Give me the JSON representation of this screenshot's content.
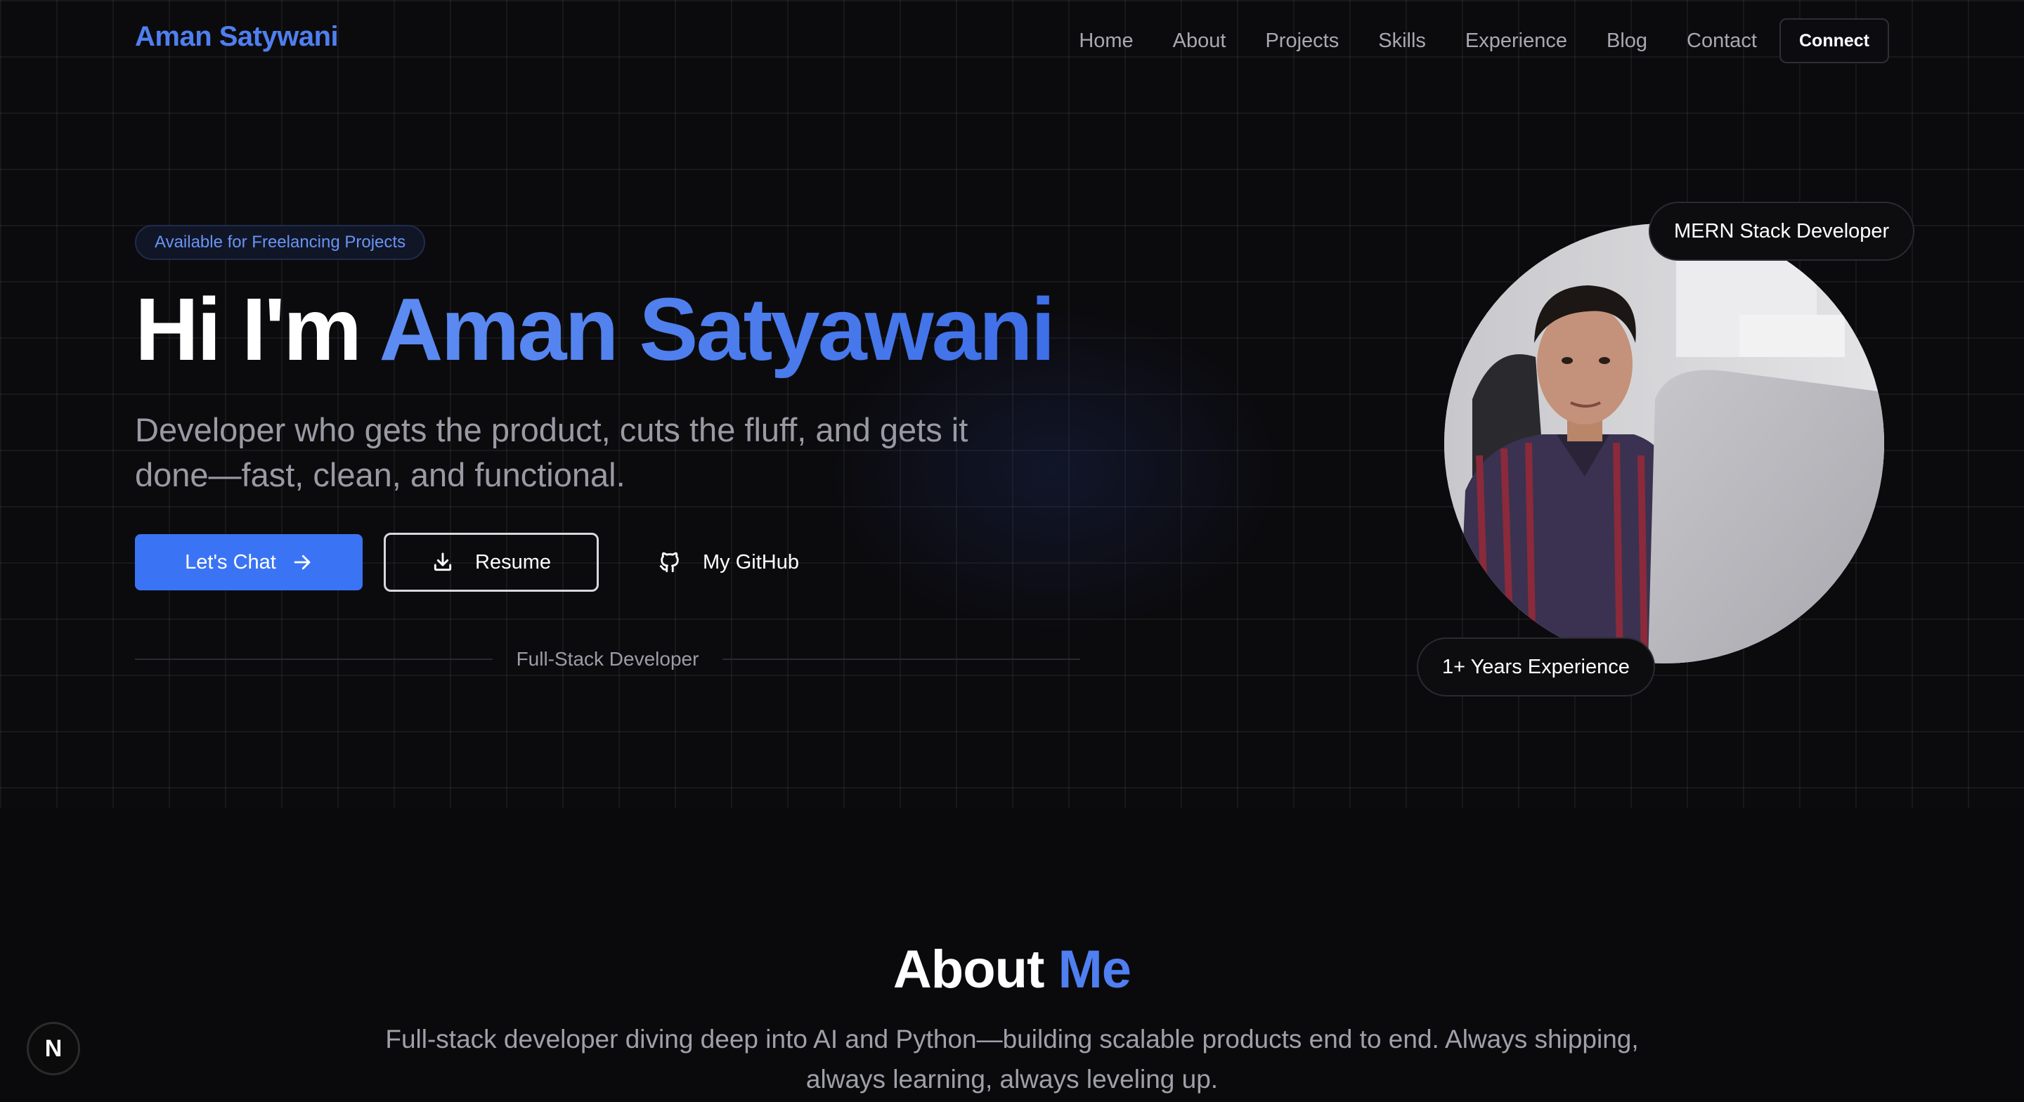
{
  "nav": {
    "brand": "Aman Satywani",
    "links": [
      "Home",
      "About",
      "Projects",
      "Skills",
      "Experience",
      "Blog",
      "Contact"
    ],
    "connect_label": "Connect"
  },
  "hero": {
    "badge": "Available for Freelancing Projects",
    "greeting": "Hi I'm",
    "name": "Aman Satyawani",
    "tagline": "Developer who gets the product, cuts the fluff, and gets it done—fast, clean, and functional.",
    "buttons": {
      "chat_label": "Let's Chat",
      "resume_label": "Resume",
      "github_label": "My GitHub"
    },
    "role": "Full-Stack Developer",
    "pills": {
      "top": "MERN Stack Developer",
      "bottom": "1+ Years Experience"
    }
  },
  "about": {
    "title_first": "About",
    "title_second": "Me",
    "text": "Full-stack developer diving deep into AI and Python—building scalable products end to end. Always shipping, always learning, always leveling up."
  },
  "dev_indicator": {
    "letter": "N"
  },
  "colors": {
    "accent": "#3a74f5",
    "brand": "#4f7ff0",
    "background": "#0a0a0c"
  },
  "icons": {
    "chat_button": "arrow-right-icon",
    "resume_button": "download-icon",
    "github_button": "github-icon",
    "dev_indicator": "nextjs-icon"
  }
}
